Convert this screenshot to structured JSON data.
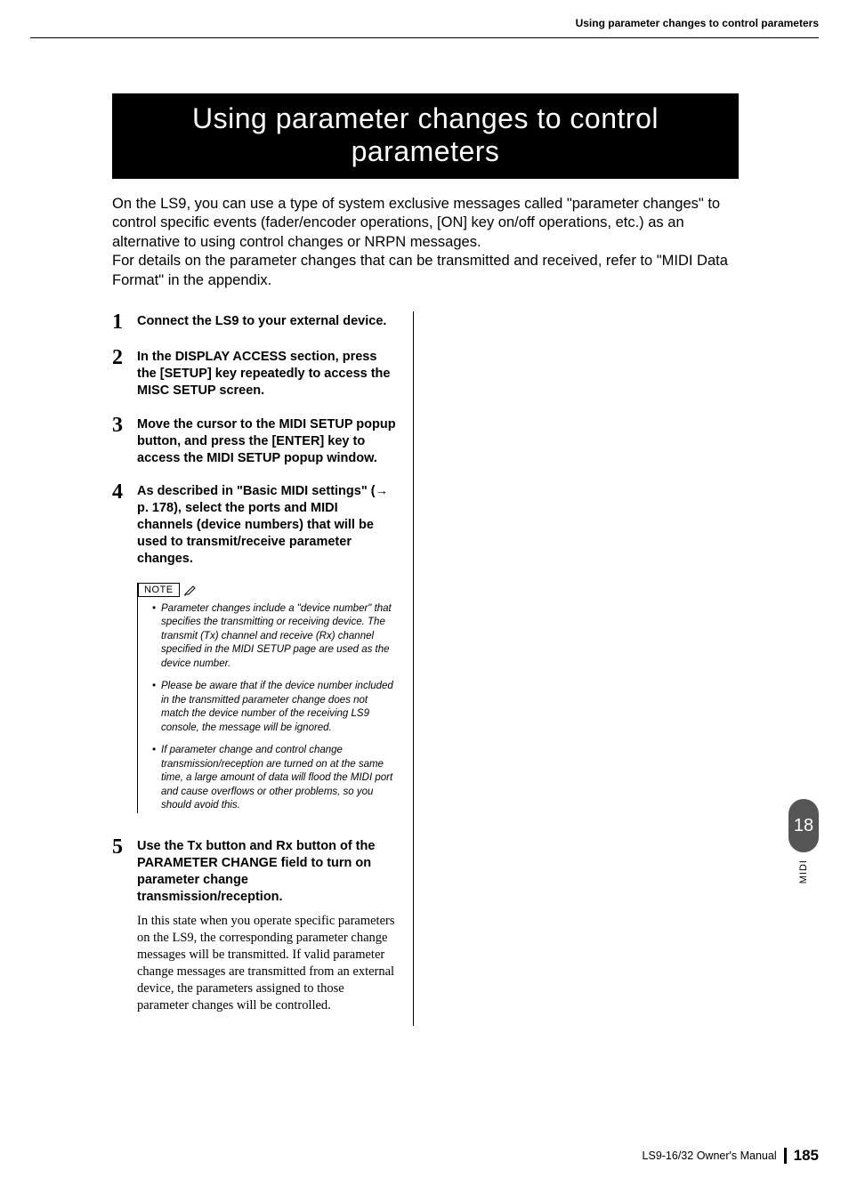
{
  "header": {
    "running": "Using parameter changes to control parameters"
  },
  "title": "Using parameter changes to control parameters",
  "intro": "On the LS9, you can use a type of system exclusive messages called \"parameter changes\" to control specific events (fader/encoder operations, [ON] key on/off operations, etc.) as an alternative to using control changes or NRPN messages.\nFor details on the parameter changes that can be transmitted and received, refer to \"MIDI Data Format\" in the appendix.",
  "steps": {
    "s1": {
      "num": "1",
      "text": "Connect the LS9 to your external device."
    },
    "s2": {
      "num": "2",
      "text": "In the DISPLAY ACCESS section, press the [SETUP] key repeatedly to access the MISC SETUP screen."
    },
    "s3": {
      "num": "3",
      "text": "Move the cursor to the MIDI SETUP popup button, and press the [ENTER] key to access the MIDI SETUP popup window."
    },
    "s4": {
      "num": "4",
      "text": "As described in \"Basic MIDI settings\" (→ p. 178), select the ports and MIDI channels (device numbers) that will be used to transmit/receive parameter changes."
    },
    "s5": {
      "num": "5",
      "text": "Use the Tx button and Rx button of the PARAMETER CHANGE field to turn on parameter change transmission/reception.",
      "body": "In this state when you operate specific parameters on the LS9, the corresponding parameter change messages will be transmitted. If valid parameter change messages are transmitted from an external device, the parameters assigned to those parameter changes will be controlled."
    }
  },
  "note": {
    "label": "NOTE",
    "items": [
      "Parameter changes include a \"device number\" that specifies the transmitting or receiving device. The transmit (Tx) channel and receive (Rx) channel specified in the MIDI SETUP page are used as the device number.",
      "Please be aware that if the device number included in the transmitted parameter change does not match the device number of the receiving LS9 console, the message will be ignored.",
      "If parameter change and control change transmission/reception are turned on at the same time, a large amount of data will flood the MIDI port and cause overflows or other problems, so you should avoid this."
    ]
  },
  "sidetab": {
    "chapter": "18",
    "label": "MIDI"
  },
  "footer": {
    "manual": "LS9-16/32  Owner's Manual",
    "page": "185"
  }
}
